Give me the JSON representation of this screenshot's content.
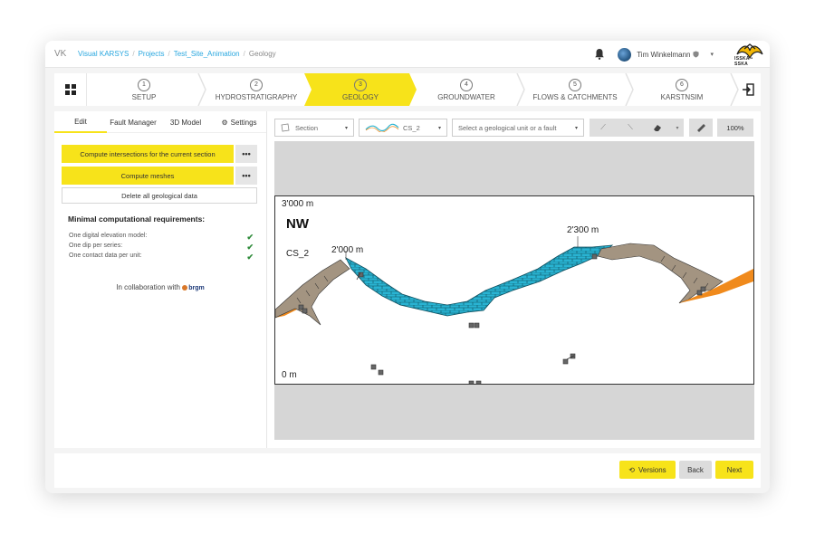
{
  "app": {
    "short": "VK"
  },
  "breadcrumb": [
    "Visual KARSYS",
    "Projects",
    "Test_Site_Animation",
    "Geology"
  ],
  "user": {
    "name": "Tim Winkelmann",
    "logo_text": "ISSKA • SSKA"
  },
  "steps": [
    {
      "num": "1",
      "label": "SETUP"
    },
    {
      "num": "2",
      "label": "HYDROSTRATIGRAPHY"
    },
    {
      "num": "3",
      "label": "GEOLOGY",
      "active": true
    },
    {
      "num": "4",
      "label": "GROUNDWATER"
    },
    {
      "num": "5",
      "label": "FLOWS & CATCHMENTS"
    },
    {
      "num": "6",
      "label": "KARSTNSIM"
    }
  ],
  "left_tabs": {
    "edit": "Edit",
    "fault_manager": "Fault Manager",
    "model3d": "3D Model",
    "settings": "Settings"
  },
  "actions": {
    "compute_intersections": "Compute intersections for the current section",
    "compute_meshes": "Compute meshes",
    "more": "•••",
    "delete_all": "Delete all geological data"
  },
  "requirements": {
    "title": "Minimal computational requirements:",
    "items": [
      "One digital elevation model:",
      "One dip per series:",
      "One contact data per unit:"
    ],
    "check": "✔"
  },
  "collab": {
    "text": "In collaboration with",
    "partner": "brgm"
  },
  "toolbar": {
    "section": "Section",
    "cs": "CS_2",
    "unit_placeholder": "Select a geological unit or a fault",
    "zoom": "100%"
  },
  "section_view": {
    "elev_top": "3'000 m",
    "elev_bottom": "0 m",
    "orientation": "NW",
    "section_name": "CS_2",
    "peak1": "2'000 m",
    "peak2": "2'300 m"
  },
  "footer": {
    "versions": "Versions",
    "back": "Back",
    "next": "Next"
  },
  "colors": {
    "accent": "#f7e31a",
    "link": "#29a7df",
    "limestone": "#29b3d2",
    "marl": "#a39481",
    "orange": "#f08a1c"
  }
}
